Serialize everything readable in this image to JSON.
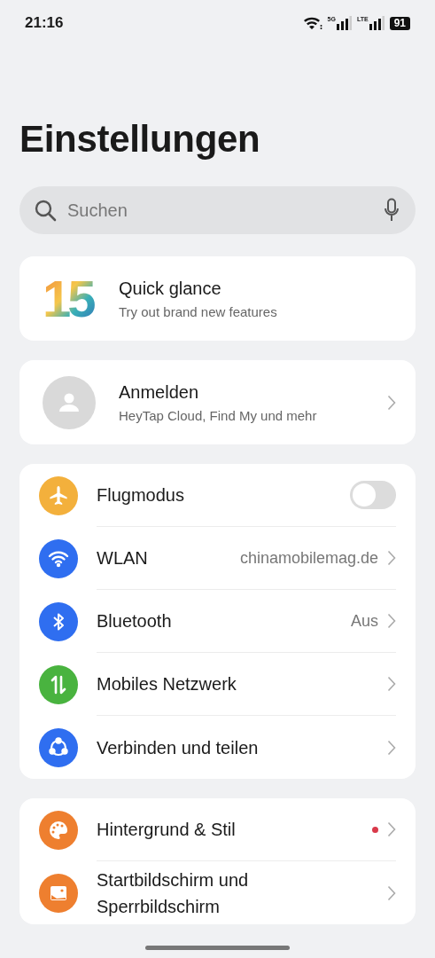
{
  "status_bar": {
    "time": "21:16",
    "network_1": "5G",
    "network_2": "LTE",
    "battery": "91"
  },
  "title": "Einstellungen",
  "search": {
    "placeholder": "Suchen"
  },
  "promo": {
    "logo": "15",
    "title": "Quick glance",
    "subtitle": "Try out brand new features"
  },
  "account": {
    "title": "Anmelden",
    "subtitle": "HeyTap Cloud, Find My und mehr"
  },
  "groups": [
    {
      "items": [
        {
          "kind": "toggle",
          "label": "Flugmodus",
          "color": "#f3b03c",
          "on": false
        },
        {
          "kind": "link",
          "label": "WLAN",
          "value": "chinamobilemag.de",
          "color": "#2f6ef0"
        },
        {
          "kind": "link",
          "label": "Bluetooth",
          "value": "Aus",
          "color": "#2f6ef0"
        },
        {
          "kind": "link",
          "label": "Mobiles Netzwerk",
          "color": "#49b33f"
        },
        {
          "kind": "link",
          "label": "Verbinden und teilen",
          "color": "#2f6ef0"
        }
      ]
    },
    {
      "items": [
        {
          "kind": "link",
          "label": "Hintergrund & Stil",
          "color": "#ee7f2f",
          "badge": true
        },
        {
          "kind": "link",
          "label": "Startbildschirm und Sperrbildschirm",
          "color": "#ee7f2f"
        }
      ]
    }
  ]
}
